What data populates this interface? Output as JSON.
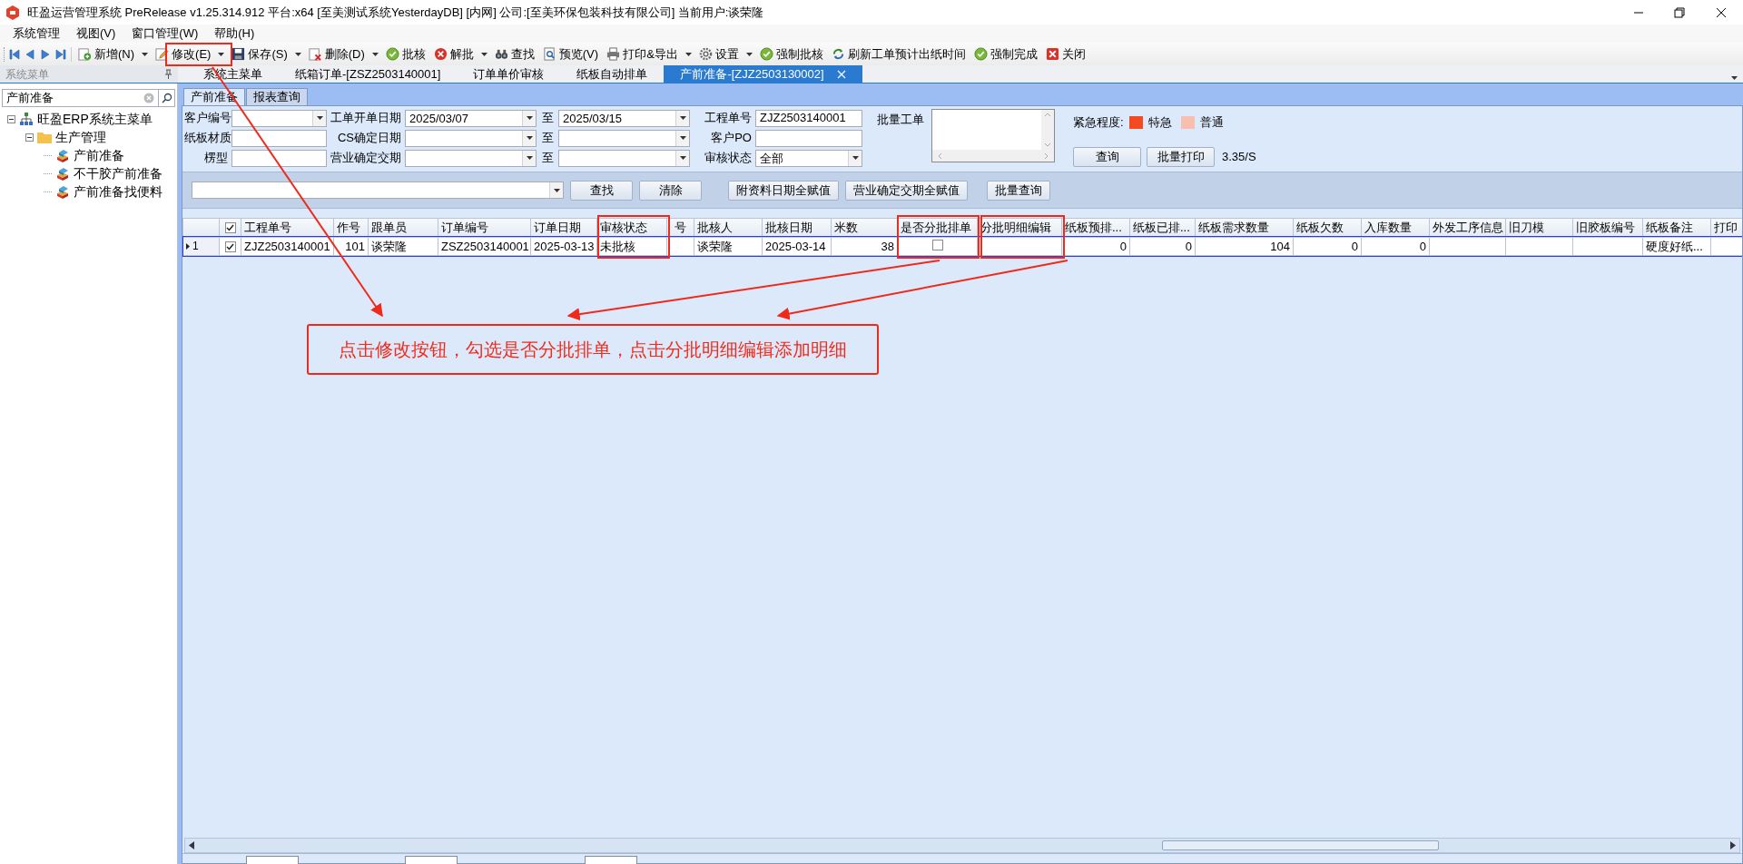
{
  "window": {
    "title": "旺盈运营管理系统 PreRelease v1.25.314.912 平台:x64  [至美测试系统YesterdayDB] [内网] 公司:[至美环保包装科技有限公司] 当前用户:谈荣隆"
  },
  "menu": [
    "系统管理",
    "视图(V)",
    "窗口管理(W)",
    "帮助(H)"
  ],
  "toolbar": [
    {
      "label": "新增(N)",
      "dropdown": true
    },
    {
      "label": "修改(E)",
      "dropdown": true
    },
    {
      "label": "保存(S)",
      "dropdown": true
    },
    {
      "label": "删除(D)",
      "dropdown": true
    },
    {
      "label": "批核",
      "dropdown": false
    },
    {
      "label": "解批",
      "dropdown": true
    },
    {
      "label": "查找",
      "dropdown": false
    },
    {
      "label": "预览(V)",
      "dropdown": false
    },
    {
      "label": "打印&导出",
      "dropdown": true
    },
    {
      "label": "设置",
      "dropdown": true
    },
    {
      "label": "强制批核",
      "dropdown": false
    },
    {
      "label": "刷新工单预计出纸时间",
      "dropdown": false
    },
    {
      "label": "强制完成",
      "dropdown": false
    },
    {
      "label": "关闭",
      "dropdown": false
    }
  ],
  "sidebar": {
    "title": "系统菜单",
    "search": {
      "value": "产前准备"
    },
    "tree": [
      {
        "label": "旺盈ERP系统主菜单",
        "expanded": true,
        "children": [
          {
            "label": "生产管理",
            "expanded": true,
            "children": [
              {
                "label": "产前准备"
              },
              {
                "label": "不干胶产前准备"
              },
              {
                "label": "产前准备找便料"
              }
            ]
          }
        ]
      }
    ]
  },
  "doc_tabs": [
    {
      "label": "系统主菜单",
      "selected": false
    },
    {
      "label": "纸箱订单-[ZSZ2503140001]",
      "selected": false
    },
    {
      "label": "订单单价审核",
      "selected": false
    },
    {
      "label": "纸板自动排单",
      "selected": false
    },
    {
      "label": "产前准备-[ZJZ2503130002]",
      "selected": true
    }
  ],
  "inner_tabs": [
    {
      "label": "产前准备",
      "selected": true
    },
    {
      "label": "报表查询",
      "selected": false
    }
  ],
  "filters": [
    [
      {
        "label": "客户编号",
        "kind": "combo"
      },
      {
        "label": "工单开单日期",
        "kind": "combo",
        "value": "2025/03/07"
      },
      {
        "label": "至",
        "kind": "combo",
        "value": "2025/03/15"
      },
      {
        "label": "工程单号",
        "kind": "input",
        "value": "ZJZ2503140001"
      }
    ],
    [
      {
        "label": "纸板材质",
        "kind": "input"
      },
      {
        "label": "CS确定日期",
        "kind": "combo"
      },
      {
        "label": "至",
        "kind": "combo"
      },
      {
        "label": "客户PO",
        "kind": "input"
      }
    ],
    [
      {
        "label": "楞型",
        "kind": "input"
      },
      {
        "label": "营业确定交期",
        "kind": "combo"
      },
      {
        "label": "至",
        "kind": "combo"
      },
      {
        "label": "审核状态",
        "kind": "combo",
        "value": "全部"
      }
    ]
  ],
  "batch_order": {
    "label": "批量工单"
  },
  "urgency": {
    "label": "紧急程度:",
    "levels": [
      {
        "label": "特急",
        "color": "#f34a22"
      },
      {
        "label": "普通",
        "color": "#f9bfae"
      }
    ]
  },
  "query_buttons": [
    "查询",
    "批量打印"
  ],
  "speed": "3.35/S",
  "action_buttons": [
    "查找",
    "清除",
    "附资料日期全赋值",
    "营业确定交期全赋值",
    "批量查询"
  ],
  "table": {
    "header_checked": true,
    "columns": [
      "工程单号",
      "作号",
      "跟单员",
      "订单编号",
      "订单日期",
      "审核状态",
      "号",
      "批核人",
      "批核日期",
      "米数",
      "是否分批排单",
      "分批明细编辑",
      "纸板预排...",
      "纸板已排...",
      "纸板需求数量",
      "纸板欠数",
      "入库数量",
      "外发工序信息",
      "旧刀模",
      "旧胶板编号",
      "纸板备注",
      "打印"
    ],
    "rows": [
      {
        "number": "1",
        "checked": true,
        "selected": true,
        "cells": [
          {
            "kind": "text",
            "text": "ZJZ2503140001"
          },
          {
            "kind": "number",
            "text": "101"
          },
          {
            "kind": "text",
            "text": "谈荣隆"
          },
          {
            "kind": "text",
            "text": "ZSZ2503140001"
          },
          {
            "kind": "text",
            "text": "2025-03-13"
          },
          {
            "kind": "text",
            "text": "未批核"
          },
          {
            "kind": "empty"
          },
          {
            "kind": "text",
            "text": "谈荣隆"
          },
          {
            "kind": "text",
            "text": "2025-03-14"
          },
          {
            "kind": "number",
            "text": "38"
          },
          {
            "kind": "checkbox",
            "checked": false
          },
          {
            "kind": "empty"
          },
          {
            "kind": "number",
            "text": "0"
          },
          {
            "kind": "number",
            "text": "0"
          },
          {
            "kind": "number",
            "text": "104"
          },
          {
            "kind": "number",
            "text": "0"
          },
          {
            "kind": "number",
            "text": "0"
          },
          {
            "kind": "empty"
          },
          {
            "kind": "empty"
          },
          {
            "kind": "empty"
          },
          {
            "kind": "text",
            "text": "硬度好纸..."
          },
          {
            "kind": "empty"
          }
        ]
      }
    ]
  },
  "annotation": {
    "text": "点击修改按钮，勾选是否分批排单，点击分批明细编辑添加明细"
  }
}
